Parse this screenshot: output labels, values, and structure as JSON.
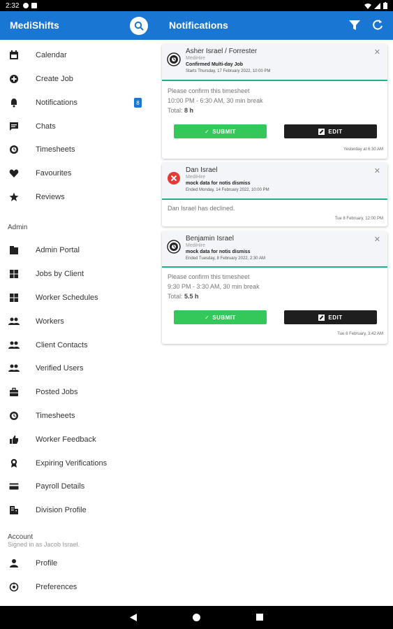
{
  "status": {
    "time": "2:32"
  },
  "app": {
    "brand": "MediShifts",
    "page_title": "Notifications"
  },
  "sidebar": {
    "top_items": [
      {
        "label": "Calendar",
        "icon": "calendar-icon"
      },
      {
        "label": "Create Job",
        "icon": "add-circle-icon"
      },
      {
        "label": "Notifications",
        "icon": "bell-icon",
        "badge": "8"
      },
      {
        "label": "Chats",
        "icon": "chat-icon"
      },
      {
        "label": "Timesheets",
        "icon": "timesheet-icon"
      },
      {
        "label": "Favourites",
        "icon": "heart-icon"
      },
      {
        "label": "Reviews",
        "icon": "star-icon"
      }
    ],
    "admin_label": "Admin",
    "admin_items": [
      {
        "label": "Admin Portal",
        "icon": "portal-icon"
      },
      {
        "label": "Jobs by Client",
        "icon": "grid-icon"
      },
      {
        "label": "Worker Schedules",
        "icon": "grid-icon"
      },
      {
        "label": "Workers",
        "icon": "people-icon"
      },
      {
        "label": "Client Contacts",
        "icon": "people-icon"
      },
      {
        "label": "Verified Users",
        "icon": "people-icon"
      },
      {
        "label": "Posted Jobs",
        "icon": "briefcase-icon"
      },
      {
        "label": "Timesheets",
        "icon": "timesheet-icon"
      },
      {
        "label": "Worker Feedback",
        "icon": "thumbs-up-icon"
      },
      {
        "label": "Expiring Verifications",
        "icon": "award-icon"
      },
      {
        "label": "Payroll Details",
        "icon": "credit-card-icon"
      },
      {
        "label": "Division Profile",
        "icon": "building-icon"
      }
    ],
    "account_label": "Account",
    "account_sub": "Signed in as Jacob Israel.",
    "account_items": [
      {
        "label": "Profile",
        "icon": "person-icon"
      },
      {
        "label": "Preferences",
        "icon": "preferences-icon"
      }
    ]
  },
  "notifications": [
    {
      "name": "Asher Israel / Forrester",
      "org": "MediHire",
      "status": "Confirmed Multi-day Job",
      "date": "Starts Thursday, 17 February 2022, 10:00 PM",
      "body_intro": "Please confirm this timesheet",
      "body_shift": "10:00 PM - 6:30 AM, 30 min break",
      "body_total_label": "Total:",
      "body_total_value": "8 h",
      "submit_label": "SUBMIT",
      "edit_label": "EDIT",
      "timestamp": "Yesterday at 6:30 AM"
    },
    {
      "name": "Dan Israel",
      "org": "MediHire",
      "status": "mock data for notis dismiss",
      "date": "Ended Monday, 14 February 2022, 10:00 PM",
      "body_intro": "Dan Israel has declined.",
      "timestamp": "Tue 8 February, 12:00 PM"
    },
    {
      "name": "Benjamin Israel",
      "org": "MediHire",
      "status": "mock data for notis dismiss",
      "date": "Ended Tuesday, 8 February 2022, 2:30 AM",
      "body_intro": "Please confirm this timesheet",
      "body_shift": "9:30 PM - 3:30 AM, 30 min break",
      "body_total_label": "Total:",
      "body_total_value": "5.5 h",
      "submit_label": "SUBMIT",
      "edit_label": "EDIT",
      "timestamp": "Tue 8 February, 3:42 AM"
    }
  ],
  "colors": {
    "primary": "#1976d2",
    "accent_green": "#20b089",
    "submit": "#34c759",
    "decline": "#e53935"
  }
}
